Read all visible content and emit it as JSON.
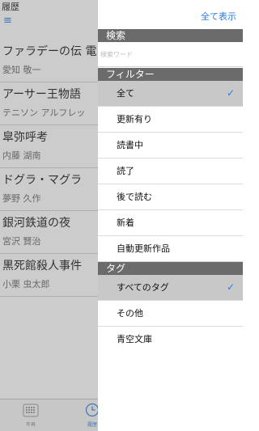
{
  "history": {
    "title": "履歴",
    "menu_icon": "≡",
    "items": [
      {
        "title": "ファラデーの伝 電",
        "author": "愛知 敬一"
      },
      {
        "title": "アーサー王物語",
        "author": "テニソン アルフレッ"
      },
      {
        "title": "皐弥呼考",
        "author": "内藤 湖南"
      },
      {
        "title": "ドグラ・マグラ",
        "author": "夢野 久作"
      },
      {
        "title": "銀河鉄道の夜",
        "author": "宮沢 賢治"
      },
      {
        "title": "黒死館殺人事件",
        "author": "小栗 虫太郎"
      }
    ]
  },
  "tabbar": {
    "ranking_label": "年再",
    "history_label": "履歴"
  },
  "panel": {
    "show_all": "全て表示",
    "search_header": "検索",
    "search_placeholder": "検索ワード",
    "filter_header": "フィルター",
    "filters": [
      {
        "label": "全て",
        "selected": true
      },
      {
        "label": "更新有り",
        "selected": false
      },
      {
        "label": "読書中",
        "selected": false
      },
      {
        "label": "読了",
        "selected": false
      },
      {
        "label": "後で読む",
        "selected": false
      },
      {
        "label": "新着",
        "selected": false
      },
      {
        "label": "自動更新作品",
        "selected": false
      }
    ],
    "tag_header": "タグ",
    "tags": [
      {
        "label": "すべてのタグ",
        "selected": true
      },
      {
        "label": "その他",
        "selected": false
      },
      {
        "label": "青空文庫",
        "selected": false
      }
    ],
    "check_mark": "✓"
  },
  "colors": {
    "accent": "#2a7de1",
    "section_header": "#6b6b6b",
    "selected_row": "#c8c8c8"
  }
}
